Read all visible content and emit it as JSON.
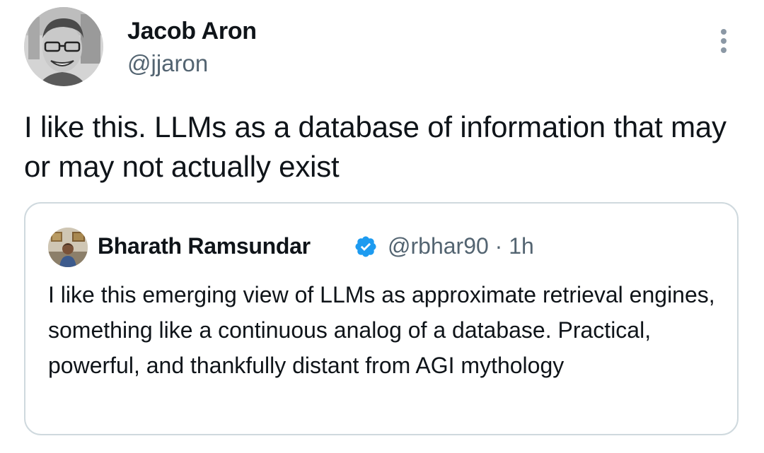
{
  "author": {
    "display_name": "Jacob Aron",
    "handle": "@jjaron",
    "avatar_icon": "profile-photo"
  },
  "menu": {
    "icon": "more-options-icon"
  },
  "tweet": {
    "text": "I like this. LLMs as a database of information that may or may not actually exist"
  },
  "quoted_tweet": {
    "author": {
      "display_name": "Bharath Ramsundar",
      "handle": "@rbhar90",
      "verified": true,
      "verified_icon": "verified-badge-icon",
      "avatar_icon": "profile-photo"
    },
    "separator": "·",
    "timestamp": "1h",
    "text": "I like this emerging view of LLMs as approximate retrieval engines, something like a continuous analog of a database. Practical, powerful, and thankfully distant from AGI mythology"
  },
  "colors": {
    "primary_text": "#0f1419",
    "secondary_text": "#536471",
    "border": "#cfd9de",
    "verified_blue": "#1d9bf0"
  }
}
